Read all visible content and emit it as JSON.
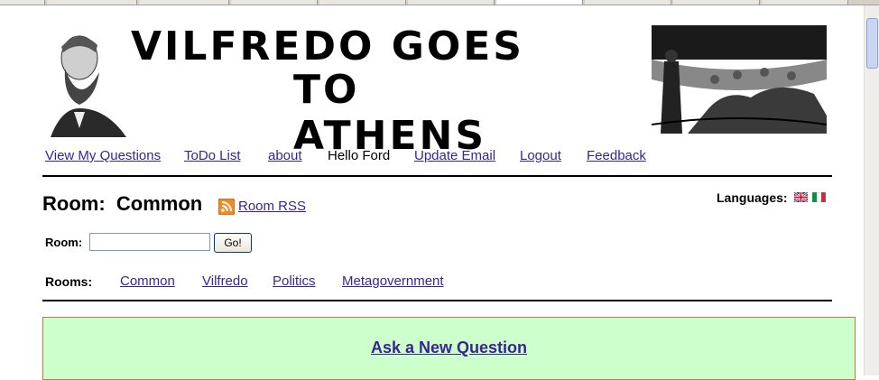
{
  "header": {
    "title_line1": "VILFREDO GOES",
    "title_line2": "TO ATHENS"
  },
  "nav": {
    "view_my_questions": "View My Questions",
    "todo_list": "ToDo List",
    "about": "about",
    "greeting": "Hello Ford",
    "update_email": "Update Email",
    "logout": "Logout",
    "feedback": "Feedback"
  },
  "room": {
    "title": "Room:  Common",
    "rss_label": "Room RSS",
    "languages_label": "Languages:",
    "form_label": "Room:",
    "input_value": "",
    "go_label": "Go!"
  },
  "rooms": {
    "label": "Rooms:",
    "items": [
      "Common",
      "Vilfredo",
      "Politics",
      "Metagovernment"
    ]
  },
  "ask": {
    "label": "Ask a New Question"
  },
  "colors": {
    "link": "#3a2494",
    "ask_background": "#ccffcc",
    "rss_orange": "#f08a24"
  }
}
